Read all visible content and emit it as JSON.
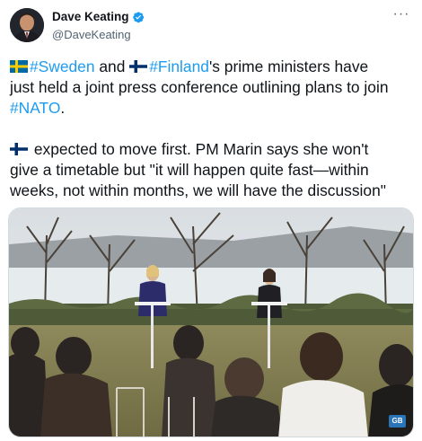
{
  "author": {
    "display_name": "Dave Keating",
    "handle": "@DaveKeating",
    "verified": true
  },
  "tweet": {
    "p1_hashtag1": "#Sweden",
    "p1_and": " and ",
    "p1_hashtag2": "#Finland",
    "p1_rest_line1": "'s prime ministers have",
    "p1_line2": "just held a joint press conference outlining plans to join",
    "p1_hashtag3": "#NATO",
    "p1_end": ".",
    "p2_line1": " expected to move first. PM Marin says she won't",
    "p2_line2": "give a timetable but \"it will happen quite fast—within",
    "p2_line3": "weeks, not within months, we will have the discussion\""
  },
  "media": {
    "watermark": "GB"
  },
  "icons": {
    "more": "more-options-icon",
    "verified": "verified-badge-icon",
    "flag_sweden": "sweden-flag-icon",
    "flag_finland": "finland-flag-icon"
  },
  "colors": {
    "link": "#1d9bf0",
    "secondary_text": "#536471",
    "verified": "#1d9bf0"
  }
}
